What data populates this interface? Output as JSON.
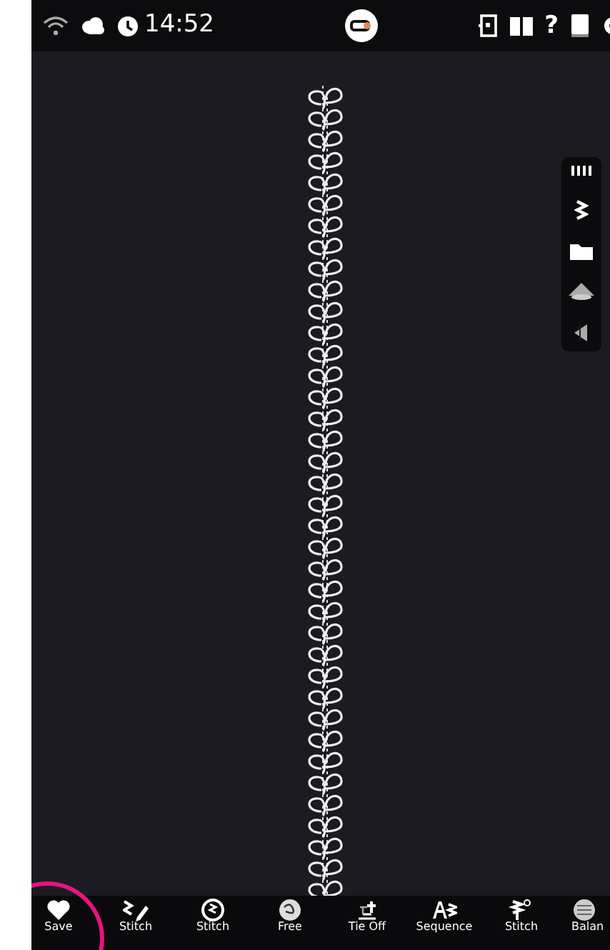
{
  "status_bar": {
    "time": "14:52",
    "help": "?"
  },
  "toolbar": [
    {
      "label": "Save",
      "highlighted": true
    },
    {
      "label": "Stitch",
      "highlighted": false
    },
    {
      "label": "Stitch",
      "highlighted": false
    },
    {
      "label": "Free",
      "highlighted": false
    },
    {
      "label": "Tie Off",
      "highlighted": false
    },
    {
      "label": "Sequence",
      "highlighted": false
    },
    {
      "label": "Stitch",
      "highlighted": false
    },
    {
      "label": "Balan",
      "highlighted": false
    }
  ]
}
